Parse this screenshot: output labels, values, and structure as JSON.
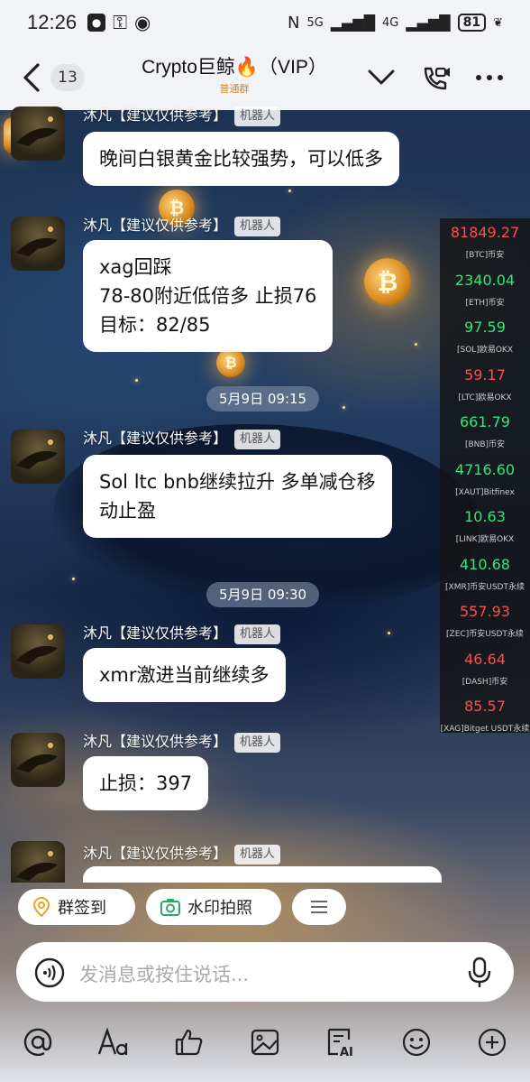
{
  "status": {
    "time": "12:26",
    "network": "5G",
    "network2": "4G",
    "battery": "81"
  },
  "header": {
    "unread_count": "13",
    "title": "Crypto巨鲸🔥（VIP）",
    "subtitle": "普通群"
  },
  "messages": [
    {
      "sender": "沐凡【建议仅供参考】",
      "tag": "机器人",
      "lines": [
        "晚间白银黄金比较强势，可以低多"
      ]
    },
    {
      "sender": "沐凡【建议仅供参考】",
      "tag": "机器人",
      "lines": [
        "xag回踩",
        "78-80附近低倍多 止损76",
        "目标：82/85"
      ]
    },
    {
      "sender": "沐凡【建议仅供参考】",
      "tag": "机器人",
      "lines": [
        "Sol ltc bnb继续拉升 多单减仓移",
        "动止盈"
      ]
    },
    {
      "sender": "沐凡【建议仅供参考】",
      "tag": "机器人",
      "lines": [
        "xmr激进当前继续多"
      ]
    },
    {
      "sender": "沐凡【建议仅供参考】",
      "tag": "机器人",
      "lines": [
        "止损：397"
      ]
    },
    {
      "sender": "沐凡【建议仅供参考】",
      "tag": "机器人",
      "lines": [
        ""
      ]
    }
  ],
  "timestamps": [
    "5月9日 09:15",
    "5月9日 09:30"
  ],
  "ticker": [
    {
      "price": "81849.27",
      "label": "[BTC]币安",
      "color": "#ff4d4d"
    },
    {
      "price": "2340.04",
      "label": "[ETH]币安",
      "color": "#2ee87a"
    },
    {
      "price": "97.59",
      "label": "[SOL]欧易OKX",
      "color": "#2ee87a"
    },
    {
      "price": "59.17",
      "label": "[LTC]欧易OKX",
      "color": "#ff4d4d"
    },
    {
      "price": "661.79",
      "label": "[BNB]币安",
      "color": "#2ee87a"
    },
    {
      "price": "4716.60",
      "label": "[XAUT]Bitfinex",
      "color": "#2ee87a"
    },
    {
      "price": "10.63",
      "label": "[LINK]欧易OKX",
      "color": "#2ee87a"
    },
    {
      "price": "410.68",
      "label": "[XMR]币安USDT永续",
      "color": "#2ee87a"
    },
    {
      "price": "557.93",
      "label": "[ZEC]币安USDT永续",
      "color": "#ff4d4d"
    },
    {
      "price": "46.64",
      "label": "[DASH]币安",
      "color": "#ff4d4d"
    },
    {
      "price": "85.57",
      "label": "[XAG]Bitget USDT永续",
      "color": "#ff4d4d"
    }
  ],
  "quick_actions": {
    "checkin": "群签到",
    "watermark": "水印拍照"
  },
  "input": {
    "placeholder": "发消息或按住说话..."
  },
  "colors": {
    "accent_orange": "#f0a020",
    "accent_green": "#2aa866"
  }
}
